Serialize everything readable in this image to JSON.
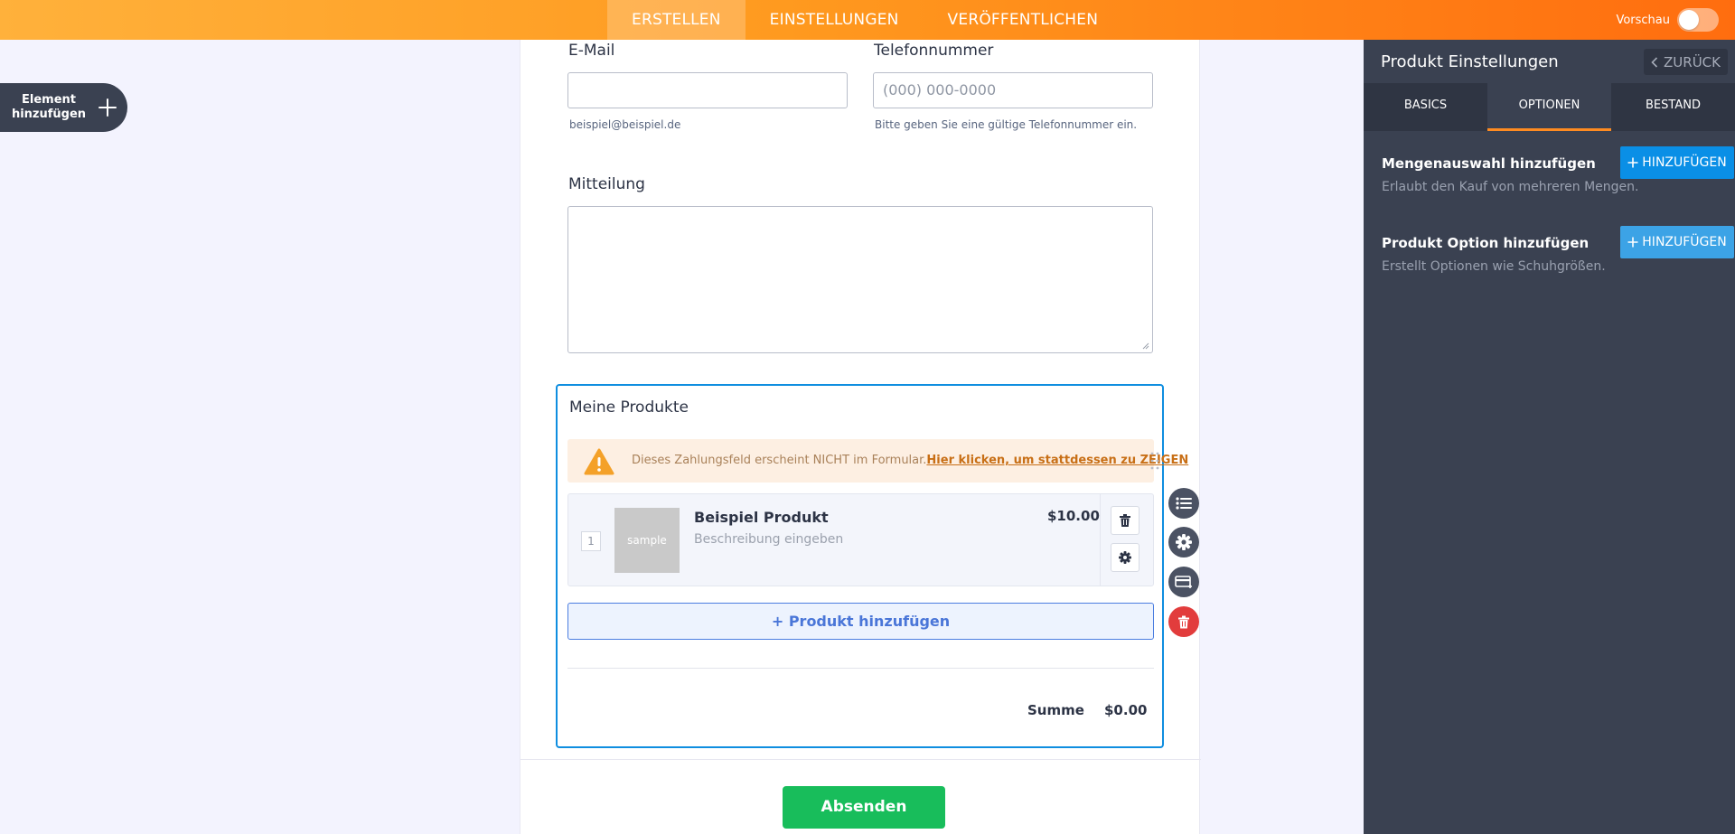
{
  "topnav": {
    "tabs": [
      {
        "label": "ERSTELLEN",
        "active": true
      },
      {
        "label": "EINSTELLUNGEN",
        "active": false
      },
      {
        "label": "VERÖFFENTLICHEN",
        "active": false
      }
    ],
    "preview_label": "Vorschau",
    "preview_on": false
  },
  "add_element": {
    "label_line1": "Element",
    "label_line2": "hinzufügen",
    "icon": "plus-icon"
  },
  "form": {
    "email": {
      "label": "E-Mail",
      "value": "",
      "placeholder": "",
      "sublabel": "beispiel@beispiel.de"
    },
    "phone": {
      "label": "Telefonnummer",
      "value": "",
      "placeholder": "(000) 000-0000",
      "sublabel": "Bitte geben Sie eine gültige Telefonnummer ein."
    },
    "message": {
      "label": "Mitteilung",
      "value": ""
    },
    "products": {
      "title": "Meine Produkte",
      "warning_text": "Dieses Zahlungsfeld erscheint NICHT im Formular.",
      "warning_link": "Hier klicken, um stattdessen zu ZEIGEN",
      "items": [
        {
          "quantity": "1",
          "image_text": "sample",
          "name": "Beispiel Produkt",
          "description": "Beschreibung eingeben",
          "price": "$10.00"
        }
      ],
      "add_product_label": "+ Produkt hinzufügen",
      "sum_label": "Summe",
      "sum_value": "$0.00"
    },
    "submit_label": "Absenden"
  },
  "field_tools": [
    "list-icon",
    "gear-icon",
    "payment-card-icon",
    "trash-icon"
  ],
  "panel": {
    "title": "Produkt Einstellungen",
    "back_label": "ZURÜCK",
    "tabs": [
      {
        "label": "BASICS",
        "active": false
      },
      {
        "label": "OPTIONEN",
        "active": true
      },
      {
        "label": "BESTAND",
        "active": false
      }
    ],
    "options": [
      {
        "title": "Mengenauswahl hinzufügen",
        "description": "Erlaubt den Kauf von mehreren Mengen.",
        "button_label": "HINZUFÜGEN",
        "button_color": "#0a8fe6"
      },
      {
        "title": "Produkt Option hinzufügen",
        "description": "Erstellt Optionen wie Schuhgrößen.",
        "button_label": "HINZUFÜGEN",
        "button_color": "#3ca3e6"
      }
    ]
  },
  "colors": {
    "accent_orange": "#ff8b21",
    "selection_blue": "#0f8ee0",
    "submit_green": "#18bd5b",
    "panel_bg": "#3a4151",
    "danger_red": "#e23c3c"
  }
}
